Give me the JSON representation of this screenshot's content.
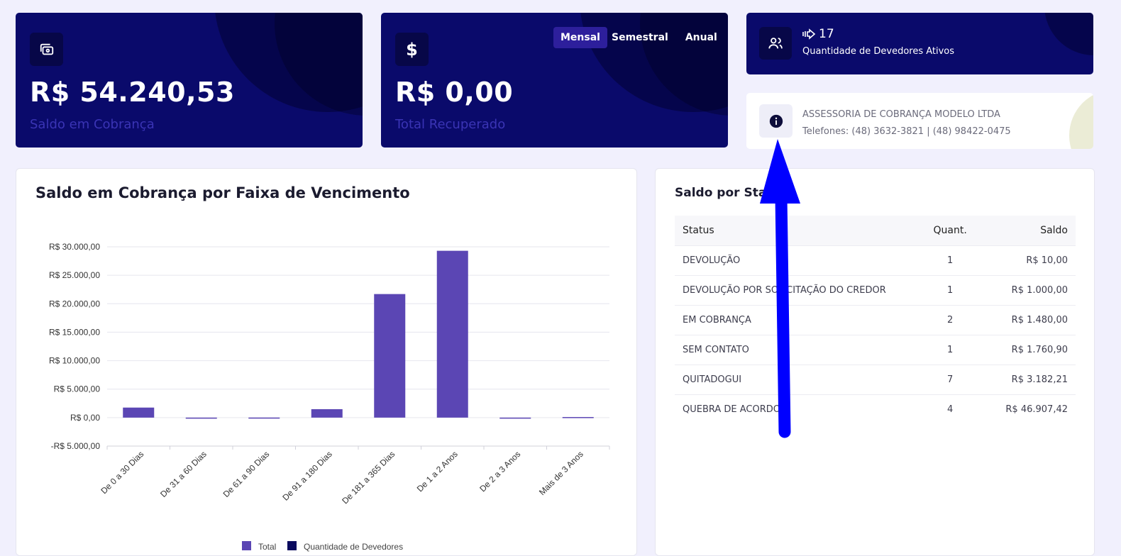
{
  "cards": {
    "saldo_cobranca": {
      "value": "R$ 54.240,53",
      "label": "Saldo em Cobrança",
      "icon": "money-icon"
    },
    "total_recuperado": {
      "value": "R$ 0,00",
      "label": "Total Recuperado",
      "icon": "dollar-icon",
      "tabs": [
        "Mensal",
        "Semestral",
        "Anual"
      ],
      "active_tab": "Mensal"
    },
    "devedores": {
      "count": "17",
      "label": "Quantidade de Devedores Ativos",
      "icon": "users-icon",
      "count_icon": "arrow-right-icon"
    },
    "empresa": {
      "name": "ASSESSORIA DE COBRANÇA MODELO LTDA",
      "phones": "Telefones: (48) 3632-3821 | (48) 98422-0475",
      "icon": "info-icon"
    }
  },
  "chart_panel": {
    "title": "Saldo em Cobrança por Faixa de Vencimento"
  },
  "chart_data": {
    "type": "bar",
    "categories": [
      "De 0 a 30 Dias",
      "De 31 a 60 Dias",
      "De 61 a 90 Dias",
      "De 91 a 180 Dias",
      "De 181 a 365 Dias",
      "De 1 a 2 Anos",
      "De 2 a 3 Anos",
      "Mais de 3 Anos"
    ],
    "series": [
      {
        "name": "Total",
        "values": [
          1760.9,
          0,
          10,
          1480,
          21700,
          29300,
          -100,
          100
        ]
      }
    ],
    "legend": [
      "Total",
      "Quantidade de Devedores"
    ],
    "ylim": [
      -5000,
      30000
    ],
    "yticks": [
      "R$ 30.000,00",
      "R$ 25.000,00",
      "R$ 20.000,00",
      "R$ 15.000,00",
      "R$ 10.000,00",
      "R$ 5.000,00",
      "R$ 0,00",
      "-R$ 5.000,00"
    ],
    "ytick_values": [
      30000,
      25000,
      20000,
      15000,
      10000,
      5000,
      0,
      -5000
    ],
    "bar_color": "#5b46b4",
    "grid": true,
    "legend_position": "bottom"
  },
  "status_panel": {
    "title": "Saldo por Status",
    "columns": [
      "Status",
      "Quant.",
      "Saldo"
    ],
    "rows": [
      {
        "status": "DEVOLUÇÃO",
        "quant": "1",
        "saldo": "R$ 10,00"
      },
      {
        "status": "DEVOLUÇÃO POR SOLICITAÇÃO DO CREDOR",
        "quant": "1",
        "saldo": "R$ 1.000,00"
      },
      {
        "status": "EM COBRANÇA",
        "quant": "2",
        "saldo": "R$ 1.480,00"
      },
      {
        "status": "SEM CONTATO",
        "quant": "1",
        "saldo": "R$ 1.760,90"
      },
      {
        "status": "QUITADOGUI",
        "quant": "7",
        "saldo": "R$ 3.182,21"
      },
      {
        "status": "QUEBRA DE ACORDO",
        "quant": "4",
        "saldo": "R$ 46.907,42"
      }
    ]
  },
  "annotation": {
    "color": "#0000ff"
  }
}
